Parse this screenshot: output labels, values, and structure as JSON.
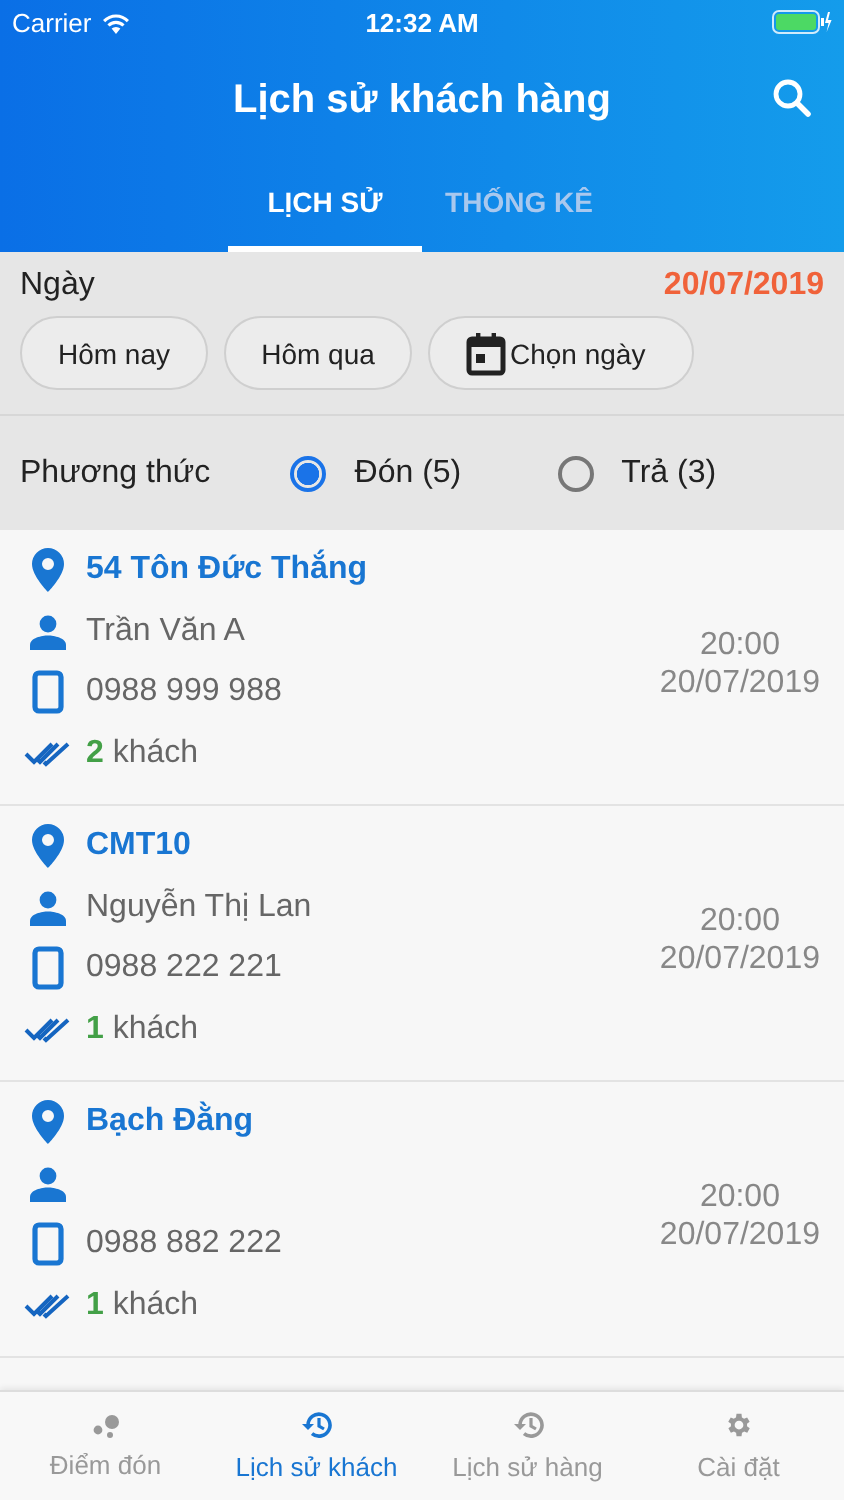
{
  "status_bar": {
    "carrier": "Carrier",
    "time": "12:32 AM"
  },
  "header": {
    "title": "Lịch sử khách hàng"
  },
  "tabs": [
    {
      "label": "LỊCH SỬ",
      "selected": true
    },
    {
      "label": "THỐNG KÊ",
      "selected": false
    }
  ],
  "date_filter": {
    "label": "Ngày",
    "date": "20/07/2019",
    "buttons": [
      {
        "label": "Hôm nay",
        "kind": "plain"
      },
      {
        "label": "Hôm qua",
        "kind": "plain"
      },
      {
        "label": "Chọn ngày",
        "kind": "calendar"
      }
    ]
  },
  "method": {
    "label": "Phương thức",
    "options": [
      {
        "label": "Đón (5)",
        "selected": true
      },
      {
        "label": "Trả (3)",
        "selected": false
      }
    ]
  },
  "trips": [
    {
      "address": "54 Tôn Đức Thắng",
      "name": "Trần Văn A",
      "phone": "0988 999 988",
      "count": "2",
      "count_unit": "khách",
      "time": "20:00",
      "date": "20/07/2019"
    },
    {
      "address": "CMT10",
      "name": "Nguyễn Thị Lan",
      "phone": "0988 222 221",
      "count": "1",
      "count_unit": "khách",
      "time": "20:00",
      "date": "20/07/2019"
    },
    {
      "address": "Bạch Đằng",
      "phone": "0988 882 222",
      "count": "1",
      "count_unit": "khách",
      "time": "20:00",
      "date": "20/07/2019"
    }
  ],
  "tab_bar": [
    {
      "label": "Điểm đón",
      "kind": "dots",
      "selected": false
    },
    {
      "label": "Lịch sử khách",
      "kind": "history",
      "selected": true
    },
    {
      "label": "Lịch sử hàng",
      "kind": "history",
      "selected": false
    },
    {
      "label": "Cài đặt",
      "kind": "gear",
      "selected": false
    }
  ]
}
